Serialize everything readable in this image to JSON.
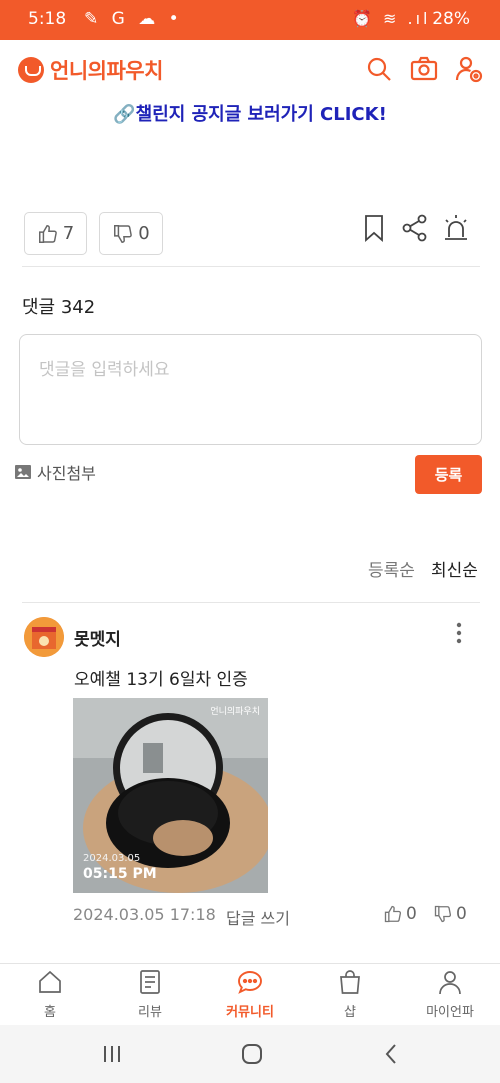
{
  "status_bar": {
    "time": "5:18",
    "left_icons": "✎ G ☁ •",
    "right_icons": "⏰ ≋ .ıl",
    "battery": "28%"
  },
  "header": {
    "logo_text": "언니의파우치",
    "icons": [
      "search-icon",
      "camera-icon",
      "profile-settings-icon"
    ]
  },
  "challenge_link": "🔗챌린지 공지글 보러가기 CLICK!",
  "reactions": {
    "like_count": "7",
    "dislike_count": "0"
  },
  "comments_section": {
    "title": "댓글 342",
    "input_placeholder": "댓글을 입력하세요",
    "attach_label": "사진첨부",
    "register_label": "등록",
    "sort_options": [
      "등록순",
      "최신순"
    ],
    "sort_selected": "최신순"
  },
  "comment": {
    "nickname": "못멧지",
    "text": "오예챌 13기 6일차 인증",
    "photo": {
      "watermark": "언니의파우치",
      "date": "2024.03.05",
      "time": "05:15 PM"
    },
    "date": "2024.03.05 17:18",
    "reply_label": "답글 쓰기",
    "like_count": "0",
    "dislike_count": "0"
  },
  "bottom_nav": [
    {
      "label": "홈",
      "icon": "home-icon"
    },
    {
      "label": "리뷰",
      "icon": "review-icon"
    },
    {
      "label": "커뮤니티",
      "icon": "community-icon",
      "active": true
    },
    {
      "label": "샵",
      "icon": "shop-icon"
    },
    {
      "label": "마이언파",
      "icon": "my-icon"
    }
  ],
  "colors": {
    "brand": "#f25a2a",
    "link": "#1f23b8"
  }
}
